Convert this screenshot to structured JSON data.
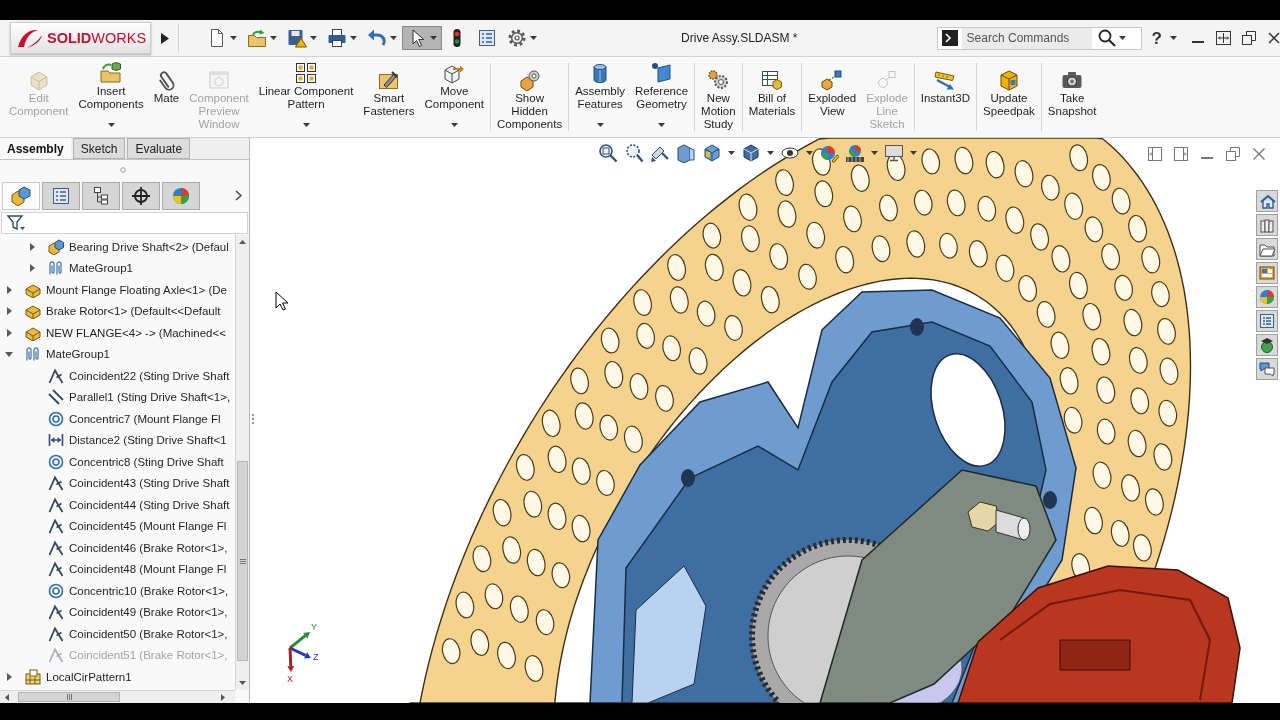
{
  "title_bar": {
    "logo": "**SOLID**WORKS",
    "quick_access": [
      {
        "kind": "new",
        "dropdown": true,
        "selected": false
      },
      {
        "kind": "open",
        "dropdown": true,
        "selected": false
      },
      {
        "kind": "save",
        "dropdown": true,
        "selected": false
      },
      {
        "kind": "print",
        "dropdown": true,
        "selected": false
      },
      {
        "kind": "undo",
        "dropdown": true,
        "selected": false
      },
      {
        "kind": "select",
        "dropdown": true,
        "selected": true
      },
      {
        "kind": "rebuild",
        "dropdown": false,
        "selected": false
      },
      {
        "kind": "file-properties",
        "dropdown": false,
        "selected": false
      },
      {
        "kind": "options",
        "dropdown": true,
        "selected": false
      }
    ],
    "document_title": "Drive Assy.SLDASM *",
    "search": {
      "placeholder": "Search Commands"
    },
    "help": {
      "label": "?",
      "dropdown": true
    }
  },
  "ribbon": {
    "groups": [
      [
        {
          "kind": "edit-component",
          "label": "Edit\nComponent",
          "disabled": true,
          "dropdown": false
        },
        {
          "kind": "insert-components",
          "label": "Insert\nComponents",
          "disabled": false,
          "dropdown": true
        },
        {
          "kind": "mate",
          "label": "Mate",
          "disabled": false,
          "dropdown": false
        },
        {
          "kind": "component-preview-window",
          "label": "Component\nPreview\nWindow",
          "disabled": true,
          "dropdown": false
        },
        {
          "kind": "linear-component-pattern",
          "label": "Linear Component\nPattern",
          "disabled": false,
          "dropdown": true
        },
        {
          "kind": "smart-fasteners",
          "label": "Smart\nFasteners",
          "disabled": false,
          "dropdown": false
        },
        {
          "kind": "move-component",
          "label": "Move\nComponent",
          "disabled": false,
          "dropdown": true
        }
      ],
      [
        {
          "kind": "show-hidden-components",
          "label": "Show\nHidden\nComponents",
          "disabled": false,
          "dropdown": false
        }
      ],
      [
        {
          "kind": "assembly-features",
          "label": "Assembly\nFeatures",
          "disabled": false,
          "dropdown": true
        },
        {
          "kind": "reference-geometry",
          "label": "Reference\nGeometry",
          "disabled": false,
          "dropdown": true
        }
      ],
      [
        {
          "kind": "new-motion-study",
          "label": "New\nMotion\nStudy",
          "disabled": false,
          "dropdown": false
        }
      ],
      [
        {
          "kind": "bill-of-materials",
          "label": "Bill of\nMaterials",
          "disabled": false,
          "dropdown": false
        }
      ],
      [
        {
          "kind": "exploded-view",
          "label": "Exploded\nView",
          "disabled": false,
          "dropdown": false
        },
        {
          "kind": "explode-line-sketch",
          "label": "Explode\nLine\nSketch",
          "disabled": true,
          "dropdown": false
        }
      ],
      [
        {
          "kind": "instant3d",
          "label": "Instant3D",
          "disabled": false,
          "dropdown": false
        }
      ],
      [
        {
          "kind": "update-speedpak",
          "label": "Update\nSpeedpak",
          "disabled": false,
          "dropdown": false
        }
      ],
      [
        {
          "kind": "take-snapshot",
          "label": "Take\nSnapshot",
          "disabled": false,
          "dropdown": false
        }
      ]
    ]
  },
  "command_tabs": [
    {
      "label": "Assembly",
      "selected": true
    },
    {
      "label": "Sketch",
      "selected": false
    },
    {
      "label": "Evaluate",
      "selected": false
    }
  ],
  "manager_tabs": [
    {
      "kind": "feature-manager",
      "selected": true
    },
    {
      "kind": "property-manager",
      "selected": false
    },
    {
      "kind": "configuration-manager",
      "selected": false
    },
    {
      "kind": "dimxpert-manager",
      "selected": false
    },
    {
      "kind": "display-manager",
      "selected": false
    }
  ],
  "tree": {
    "items": [
      {
        "children": [
          {
            "kind": "assembly",
            "label": "Bearing Drive Shaft<2> (Defaul",
            "expanded": false,
            "disabled": false
          },
          {
            "kind": "mategroup",
            "label": "MateGroup1",
            "expanded": false,
            "disabled": false
          }
        ]
      },
      {
        "kind": "part",
        "label": "Mount Flange Floating Axle<1> (De",
        "expanded": false,
        "disabled": false
      },
      {
        "kind": "part",
        "label": "Brake Rotor<1> (Default<<Default",
        "expanded": false,
        "disabled": false
      },
      {
        "kind": "part",
        "label": "NEW FLANGE<4> -> (Machined<<",
        "expanded": false,
        "disabled": false
      },
      {
        "kind": "mategroup",
        "label": "MateGroup1",
        "expanded": true,
        "disabled": false,
        "children": [
          {
            "kind": "coincident",
            "label": "Coincident22 (Sting Drive Shaft",
            "disabled": false
          },
          {
            "kind": "parallel",
            "label": "Parallel1 (Sting Drive Shaft<1>,",
            "disabled": false
          },
          {
            "kind": "concentric",
            "label": "Concentric7 (Mount Flange Fl",
            "disabled": false
          },
          {
            "kind": "distance",
            "label": "Distance2 (Sting Drive Shaft<1",
            "disabled": false
          },
          {
            "kind": "concentric",
            "label": "Concentric8 (Sting Drive Shaft",
            "disabled": false
          },
          {
            "kind": "coincident",
            "label": "Coincident43 (Sting Drive Shaft",
            "disabled": false
          },
          {
            "kind": "coincident",
            "label": "Coincident44 (Sting Drive Shaft",
            "disabled": false
          },
          {
            "kind": "coincident",
            "label": "Coincident45 (Mount Flange Fl",
            "disabled": false
          },
          {
            "kind": "coincident",
            "label": "Coincident46 (Brake Rotor<1>,",
            "disabled": false
          },
          {
            "kind": "coincident",
            "label": "Coincident48 (Mount Flange Fl",
            "disabled": false
          },
          {
            "kind": "concentric",
            "label": "Concentric10 (Brake Rotor<1>,",
            "disabled": false
          },
          {
            "kind": "coincident",
            "label": "Coincident49 (Brake Rotor<1>,",
            "disabled": false
          },
          {
            "kind": "coincident",
            "label": "Coincident50 (Brake Rotor<1>,",
            "disabled": false
          },
          {
            "kind": "coincident",
            "label": "Coincident51 (Brake Rotor<1>,",
            "disabled": true
          }
        ]
      },
      {
        "kind": "pattern",
        "label": "LocalCirPattern1",
        "expanded": false,
        "disabled": false
      }
    ]
  },
  "viewport": {
    "triad": [
      {
        "label": "Y",
        "color": "#2e8b2e"
      },
      {
        "label": "Z",
        "color": "#2838b8"
      },
      {
        "label": "X",
        "color": "#a82020"
      }
    ]
  }
}
